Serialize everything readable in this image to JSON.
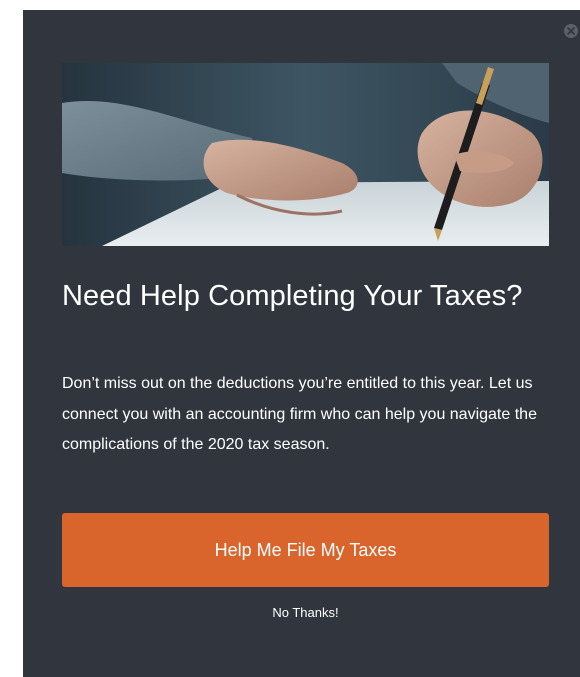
{
  "popup": {
    "close_icon": "close-icon",
    "hero_image": "hand-writing-pen-image",
    "headline": "Need Help Completing Your Taxes?",
    "body": "Don’t miss out on the deductions you’re entitled to this year. Let us connect you with an accounting firm who can help you navigate the complications of the 2020 tax season.",
    "cta_label": "Help Me File My Taxes",
    "dismiss_label": "No Thanks!"
  },
  "colors": {
    "background": "#31353d",
    "cta": "#d9642c",
    "text": "#ffffff",
    "close": "#5c6169"
  }
}
